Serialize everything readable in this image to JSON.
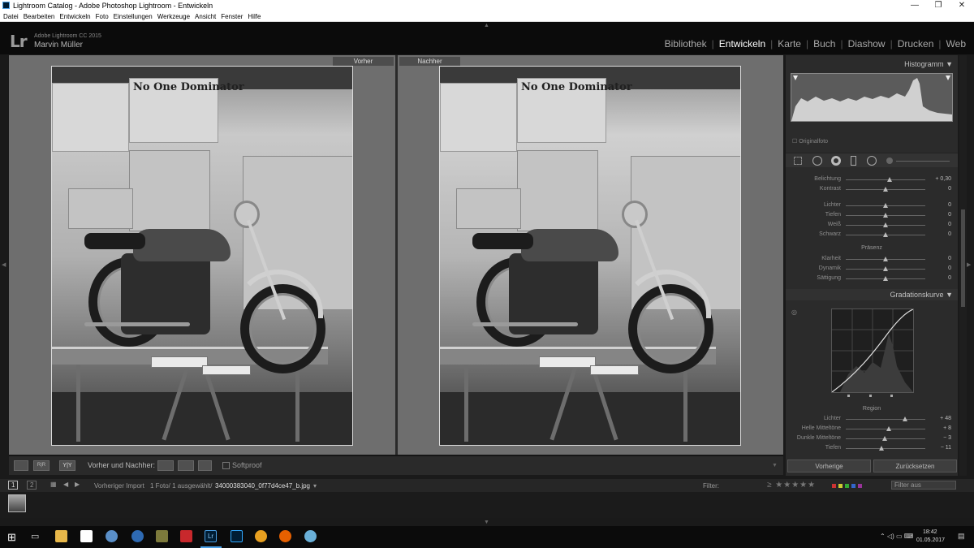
{
  "window": {
    "title": "Lightroom Catalog - Adobe Photoshop Lightroom - Entwickeln",
    "minimize": "—",
    "maximize": "❐",
    "close": "✕"
  },
  "menu": [
    "Datei",
    "Bearbeiten",
    "Entwickeln",
    "Foto",
    "Einstellungen",
    "Werkzeuge",
    "Ansicht",
    "Fenster",
    "Hilfe"
  ],
  "identity": {
    "logo": "Lr",
    "product": "Adobe Lightroom CC 2015",
    "user": "Marvin Müller"
  },
  "modules": [
    {
      "label": "Bibliothek",
      "active": false
    },
    {
      "label": "Entwickeln",
      "active": true
    },
    {
      "label": "Karte",
      "active": false
    },
    {
      "label": "Buch",
      "active": false
    },
    {
      "label": "Diashow",
      "active": false
    },
    {
      "label": "Drucken",
      "active": false
    },
    {
      "label": "Web",
      "active": false
    }
  ],
  "compare": {
    "before_label": "Vorher",
    "after_label": "Nachher",
    "poster_text": "No One Dominator"
  },
  "toolbar": {
    "mode_label": "Vorher und Nachher:",
    "softproof_label": "Softproof",
    "yy_label": "Y|Y",
    "rr_label": "R|R"
  },
  "panel": {
    "histogram_title": "Histogramm",
    "original_photo": "Originalfoto",
    "sliders_basic": [
      {
        "label": "Belichtung",
        "value": "+ 0,30",
        "pos": 0.55
      },
      {
        "label": "Kontrast",
        "value": "0",
        "pos": 0.5
      },
      {
        "label": "Lichter",
        "value": "0",
        "pos": 0.5
      },
      {
        "label": "Tiefen",
        "value": "0",
        "pos": 0.5
      },
      {
        "label": "Weiß",
        "value": "0",
        "pos": 0.5
      },
      {
        "label": "Schwarz",
        "value": "0",
        "pos": 0.5
      }
    ],
    "presence_title": "Präsenz",
    "sliders_presence": [
      {
        "label": "Klarheit",
        "value": "0",
        "pos": 0.5
      },
      {
        "label": "Dynamik",
        "value": "0",
        "pos": 0.5
      },
      {
        "label": "Sättigung",
        "value": "0",
        "pos": 0.5
      }
    ],
    "curve_title": "Gradationskurve",
    "region_title": "Region",
    "sliders_region": [
      {
        "label": "Lichter",
        "value": "+ 48",
        "pos": 0.74
      },
      {
        "label": "Helle Mitteltöne",
        "value": "+ 8",
        "pos": 0.54
      },
      {
        "label": "Dunkle Mitteltöne",
        "value": "− 3",
        "pos": 0.49
      },
      {
        "label": "Tiefen",
        "value": "− 11",
        "pos": 0.45
      }
    ],
    "prev_button": "Vorherige",
    "reset_button": "Zurücksetzen"
  },
  "filmstrip": {
    "view1": "1",
    "view2": "2",
    "source": "Vorheriger Import",
    "count": "1 Foto/ 1 ausgewählt/",
    "filename": "34000383040_0f77d4ce47_b.jpg",
    "filter_label": "Filter:",
    "filter_select": "Filter aus"
  },
  "taskbar": {
    "time": "18:42",
    "date": "01.05.2017"
  },
  "colors": {
    "accent": "#4aa0e6",
    "panel_bg": "#2b2b2b",
    "workspace_bg": "#6e6e6e"
  }
}
